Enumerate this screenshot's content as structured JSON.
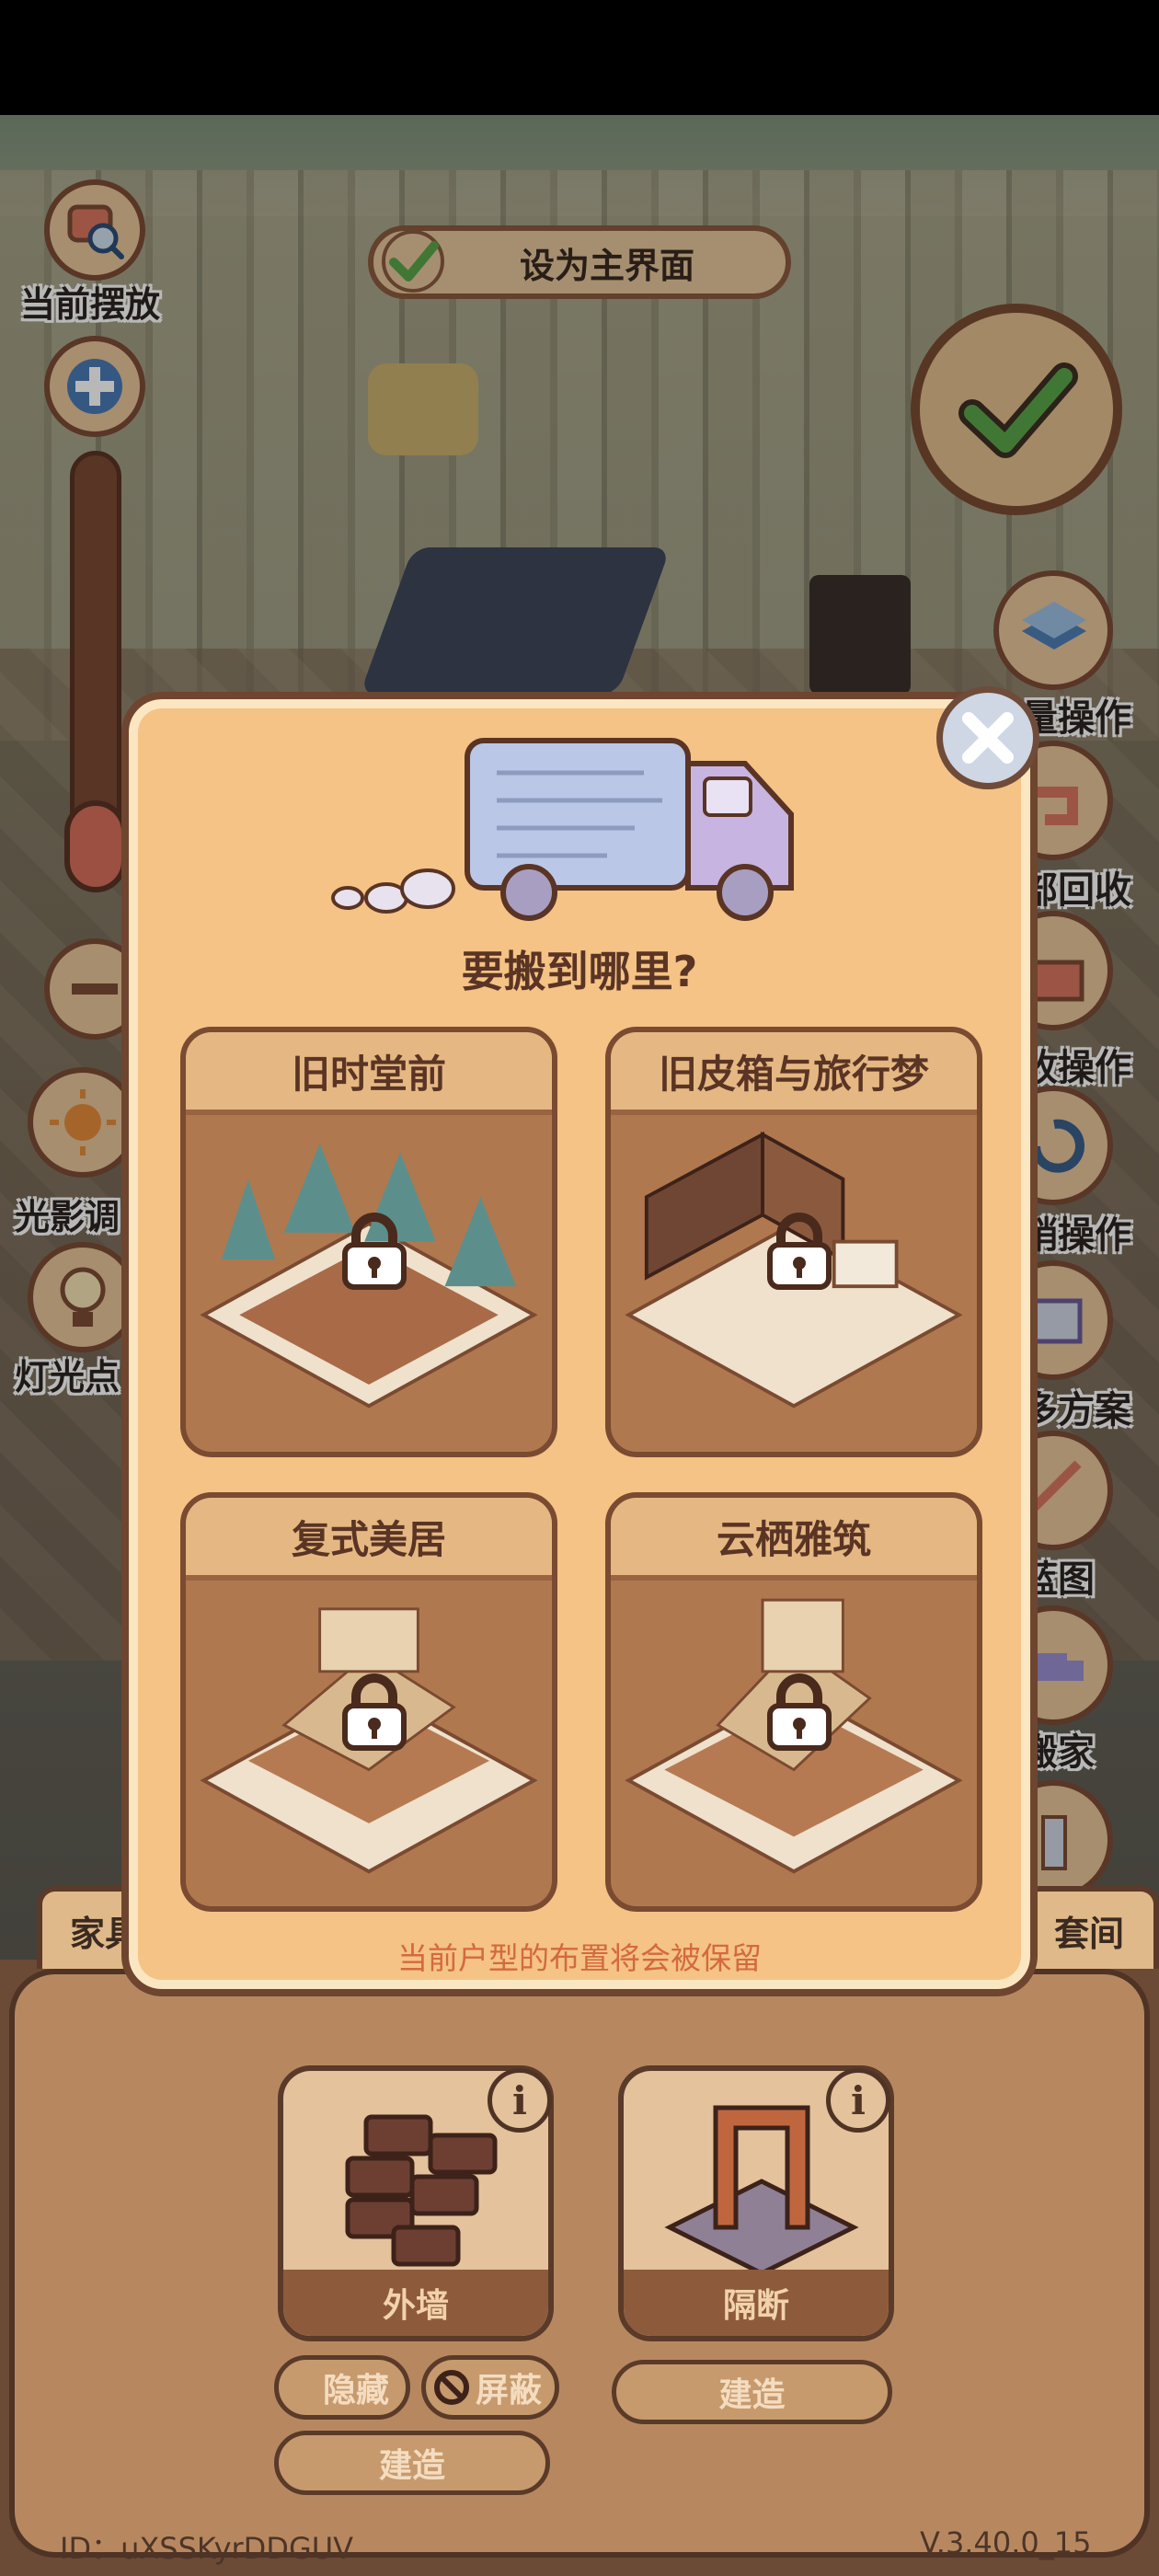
{
  "toolbar_left": {
    "current_placement": "当前摆放",
    "lighting_adjust": "光影调",
    "light_label": "灯光点"
  },
  "set_main": {
    "label": "设为主界面"
  },
  "toolbar_right": {
    "batch_op": "量操作",
    "recycle_all": "部回收",
    "store_op": "收操作",
    "undo_op": "销操作",
    "plans": "多方案",
    "blueprint": "蓝图",
    "move_house": "搬家"
  },
  "dialog": {
    "title": "要搬到哪里?",
    "cards": [
      {
        "name": "旧时堂前"
      },
      {
        "name": "旧皮箱与旅行梦"
      },
      {
        "name": "复式美居"
      },
      {
        "name": "云栖雅筑"
      }
    ],
    "note": "当前户型的布置将会被保留"
  },
  "bottom": {
    "tab_left": "家具",
    "tab_right": "套间",
    "outer_wall": "外墙",
    "partition": "隔断",
    "hide": "隐藏",
    "shield": "屏蔽",
    "build": "建造",
    "info": "i"
  },
  "footer": {
    "id": "ID：uXSSKyrDDGUV",
    "version": "V.3.40.0_15"
  },
  "colors": {
    "dialog_bg": "#f4c385",
    "card_body": "#b0784f",
    "note_orange": "#d36a3d",
    "check_green": "#5aa64a"
  }
}
